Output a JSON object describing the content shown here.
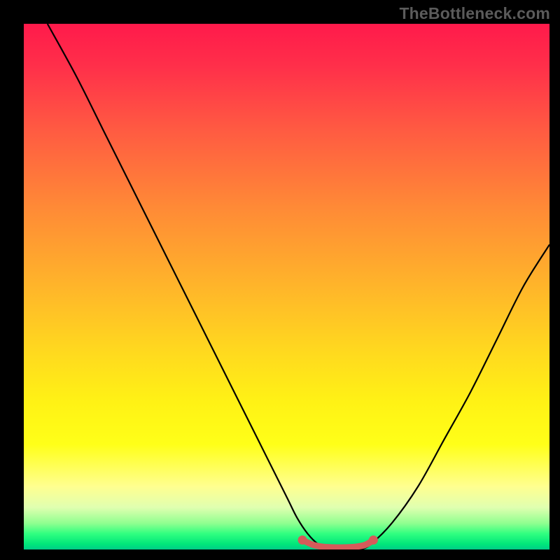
{
  "watermark": "TheBottleneck.com",
  "chart_data": {
    "type": "line",
    "title": "",
    "xlabel": "",
    "ylabel": "",
    "xlim": [
      0,
      100
    ],
    "ylim": [
      0,
      100
    ],
    "gradient_colors": {
      "top": "#ff1a4b",
      "mid_upper": "#ff8a36",
      "mid": "#ffd81f",
      "mid_lower": "#ffff18",
      "bottom": "#00cc88"
    },
    "series": [
      {
        "name": "bottleneck-curve",
        "color": "#000000",
        "x": [
          4.5,
          10,
          15,
          20,
          25,
          30,
          35,
          40,
          45,
          50,
          52,
          54,
          56,
          58,
          60,
          62,
          64,
          66,
          70,
          75,
          80,
          85,
          90,
          95,
          100
        ],
        "y": [
          100,
          90,
          80,
          70,
          60,
          50,
          40,
          30,
          20,
          10,
          6,
          3,
          1,
          0,
          0,
          0,
          0,
          1,
          5,
          12,
          21,
          30,
          40,
          50,
          58
        ]
      },
      {
        "name": "optimal-range-marker",
        "color": "#d65a5a",
        "x": [
          53,
          55,
          57,
          59,
          61,
          63,
          65,
          66.5
        ],
        "y": [
          1.8,
          0.9,
          0.5,
          0.4,
          0.4,
          0.5,
          0.9,
          1.8
        ]
      }
    ],
    "marker_endpoints": {
      "left": {
        "x": 53,
        "y": 1.8
      },
      "right": {
        "x": 66.5,
        "y": 1.8
      }
    }
  }
}
